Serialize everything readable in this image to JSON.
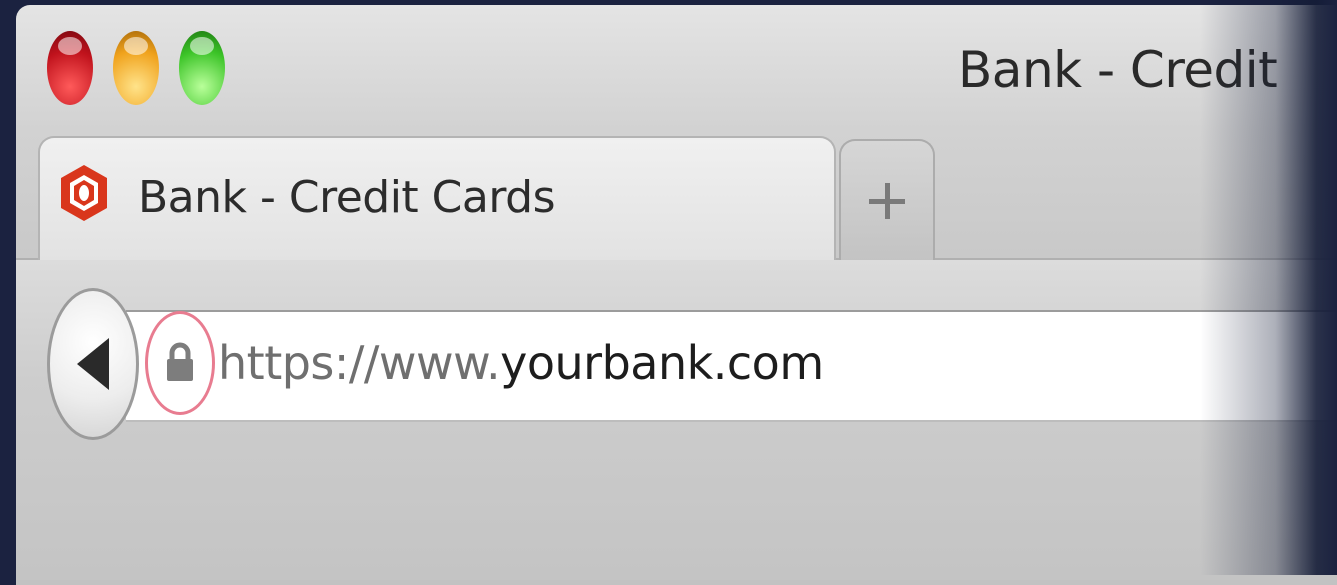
{
  "window": {
    "title": "Bank - Credit"
  },
  "tab": {
    "title": "Bank - Credit Cards",
    "favicon": "bank-logo-icon"
  },
  "new_tab": {
    "icon": "plus-icon"
  },
  "navigation": {
    "back_icon": "back-arrow-icon"
  },
  "address_bar": {
    "security_icon": "lock-icon",
    "url_prefix": "https://www.",
    "url_domain": "yourbank.com",
    "highlight_color": "#e87c90"
  },
  "colors": {
    "close": "#c0121c",
    "minimize": "#f0a21c",
    "zoom": "#3cc428",
    "favicon": "#d9361c"
  }
}
